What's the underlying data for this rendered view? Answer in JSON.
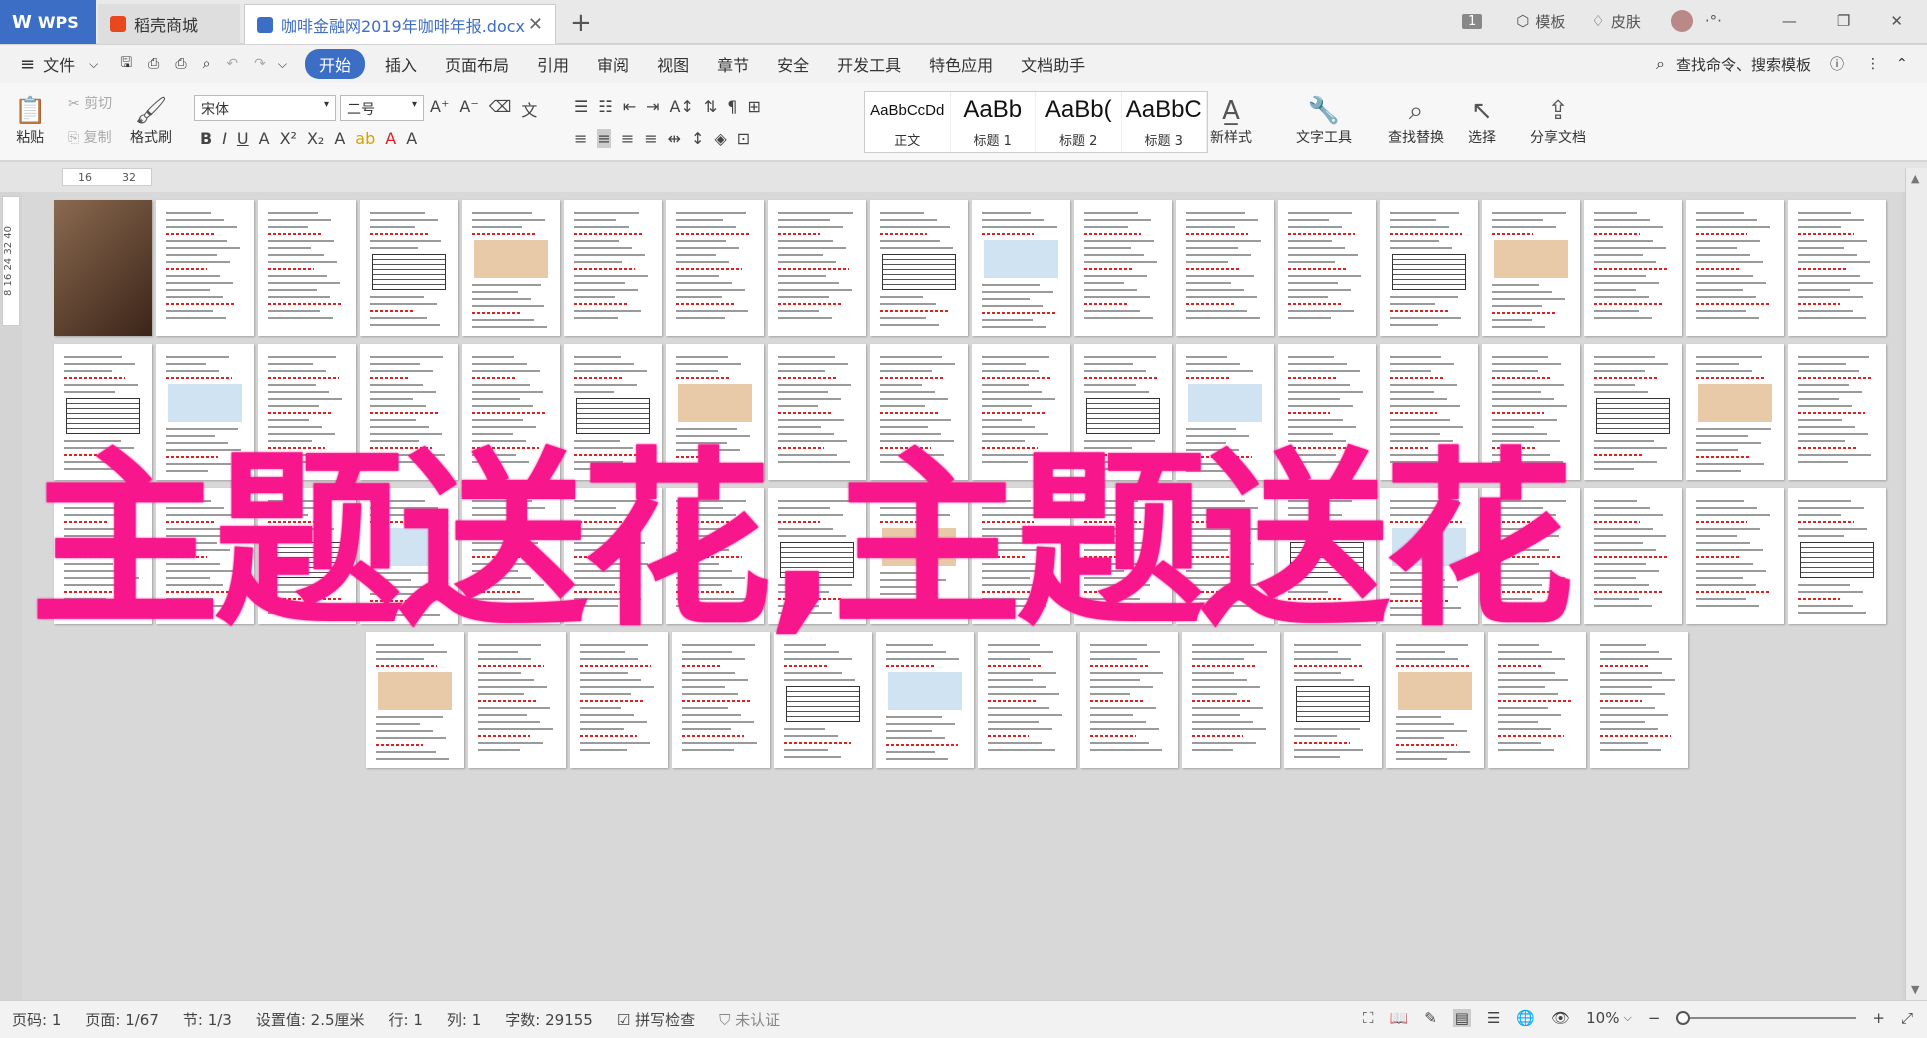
{
  "titlebar": {
    "tabs": [
      {
        "label": "WPS",
        "color": "#3c6ec6"
      },
      {
        "label": "稻壳商城",
        "color": "#e8471f"
      },
      {
        "label": "咖啡金融网2019年咖啡年报.docx",
        "color": "#3c6ec6"
      }
    ],
    "page_badge": "1",
    "template_label": "模板",
    "skin_label": "皮肤"
  },
  "menubar": {
    "file": "文件",
    "items": [
      "开始",
      "插入",
      "页面布局",
      "引用",
      "审阅",
      "视图",
      "章节",
      "安全",
      "开发工具",
      "特色应用",
      "文档助手"
    ],
    "active": "开始",
    "search": "查找命令、搜索模板"
  },
  "ribbon": {
    "paste": "粘贴",
    "cut": "剪切",
    "copy": "复制",
    "format_painter": "格式刷",
    "font_name": "宋体",
    "font_size": "二号",
    "styles": [
      {
        "sample": "AaBbCcDd",
        "label": "正文"
      },
      {
        "sample": "AaBb",
        "label": "标题 1"
      },
      {
        "sample": "AaBb(",
        "label": "标题 2"
      },
      {
        "sample": "AaBbC",
        "label": "标题 3"
      }
    ],
    "new_style": "新样式",
    "text_tools": "文字工具",
    "find_replace": "查找替换",
    "select": "选择",
    "share": "分享文档"
  },
  "ruler": {
    "marks": [
      "16",
      "32"
    ]
  },
  "left_ruler": "8 16 24 32 40",
  "overlay_text": "主题送花,主题送花",
  "status": {
    "page_num": "页码: 1",
    "page": "页面: 1/67",
    "section": "节: 1/3",
    "setting": "设置值: 2.5厘米",
    "row": "行: 1",
    "col": "列: 1",
    "words": "字数: 29155",
    "spell": "拼写检查",
    "cert": "未认证",
    "zoom": "10%"
  }
}
